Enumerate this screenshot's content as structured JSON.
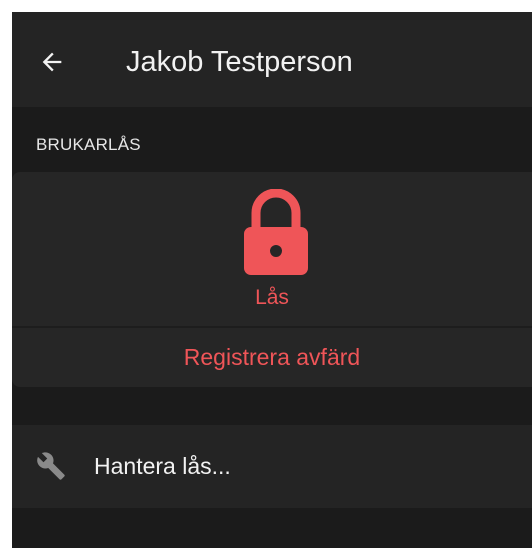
{
  "app_bar": {
    "back_icon": "arrow-left-icon",
    "title": "Jakob Testperson"
  },
  "user_lock": {
    "section_header": "BRUKARLÅS",
    "lock_icon": "padlock-closed-icon",
    "lock_label": "Lås",
    "register_departure_label": "Registrera avfärd"
  },
  "manage": {
    "icon": "wrench-icon",
    "label": "Hantera lås..."
  },
  "colors": {
    "accent": "#ef5558",
    "background": "#1b1b1b",
    "surface": "#262626",
    "app_bar": "#242424",
    "text_primary": "#f2f2f2"
  }
}
